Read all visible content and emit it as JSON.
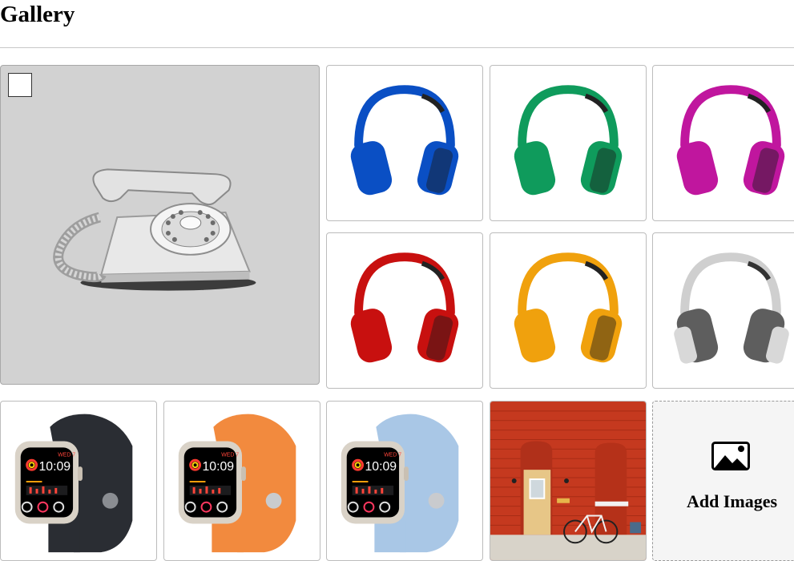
{
  "page": {
    "title": "Gallery"
  },
  "add_tile": {
    "label": "Add Images",
    "icon": "image-icon"
  },
  "colors": {
    "headphones": [
      "#0a4fc4",
      "#0f9b5c",
      "#c0169e",
      "#c8100f",
      "#f0a10d",
      "#9c9c9c"
    ],
    "watch_bands": [
      "#2a2d33",
      "#f28a3e",
      "#a9c7e6"
    ],
    "wall": "#c5391f"
  },
  "tiles": [
    {
      "name": "telephone",
      "selected": false
    },
    {
      "name": "headphones-blue"
    },
    {
      "name": "headphones-green"
    },
    {
      "name": "headphones-magenta"
    },
    {
      "name": "headphones-red"
    },
    {
      "name": "headphones-orange"
    },
    {
      "name": "headphones-gray"
    },
    {
      "name": "watch-midnight",
      "time": "10:09",
      "date": "WED 7"
    },
    {
      "name": "watch-orange",
      "time": "10:09",
      "date": "WED 7"
    },
    {
      "name": "watch-blue",
      "time": "10:09",
      "date": "WED 7"
    },
    {
      "name": "red-brick-wall"
    }
  ]
}
